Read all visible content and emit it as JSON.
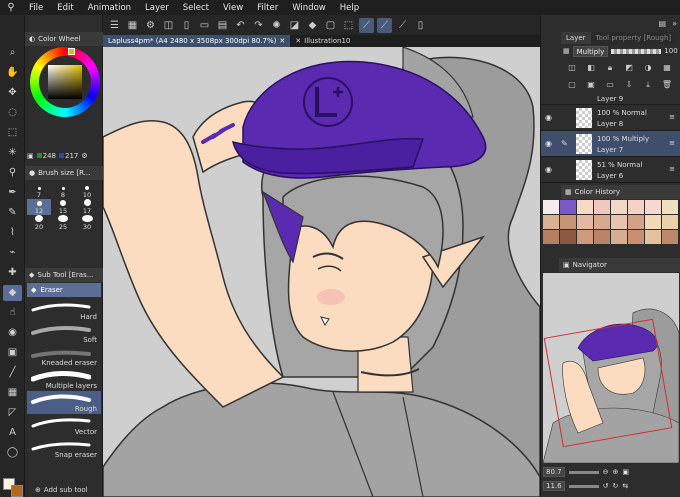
{
  "menu": [
    "File",
    "Edit",
    "Animation",
    "Layer",
    "Select",
    "View",
    "Filter",
    "Window",
    "Help"
  ],
  "tabs": [
    {
      "label": "Lapluss4pm* (A4 2480 x 3508px 300dpi 80.7%)",
      "active": true
    },
    {
      "label": "Illustration10",
      "active": false
    }
  ],
  "left_panel": {
    "color_wheel_title": "Color Wheel",
    "rgb_values": [
      "248",
      "217"
    ],
    "brush_size_title": "Brush size [R...",
    "brush_sizes": [
      "7",
      "8",
      "10",
      "12",
      "15",
      "17",
      "20",
      "25",
      "30"
    ],
    "selected_brush_size": "12",
    "sub_tool_title": "Sub Tool [Eras...",
    "active_subtool": "Eraser",
    "erasers": [
      "Hard",
      "Soft",
      "Kneaded eraser",
      "Multiple layers",
      "Rough",
      "Vector",
      "Snap eraser"
    ],
    "selected_eraser": "Rough",
    "add_sub_tool": "Add sub tool"
  },
  "right_panel": {
    "layer_tab": "Layer",
    "tool_property_tab": "Tool property [Rough]",
    "blend_mode": "Multiply",
    "opacity": "100",
    "layers": [
      {
        "top_label": "100 % Normal",
        "name": "Layer 8",
        "selected": false
      },
      {
        "top_label": "100 % Multiply",
        "name": "Layer 7",
        "selected": true
      },
      {
        "top_label": "51 % Normal",
        "name": "Layer 6",
        "selected": false
      }
    ],
    "partial_layer_name": "Layer 9",
    "color_history_title": "Color History",
    "color_history": [
      "#f4ecec",
      "#7a58c8",
      "#f7d9c6",
      "#f3c6c0",
      "#f0d7c9",
      "#f6d1c7",
      "#f7d7d2",
      "#efe1bf",
      "#d9b294",
      "#c89377",
      "#e6b8a3",
      "#d8a98e",
      "#e9c3ad",
      "#d5a089",
      "#f2d8b9",
      "#e9d0aa",
      "#b57f62",
      "#8c5a43",
      "#cf9a7c",
      "#b98367",
      "#d6ac92",
      "#c98f72",
      "#e3c09f",
      "#bb8a6d"
    ],
    "navigator_title": "Navigator",
    "zoom": "80.7",
    "rotation": "11.6"
  },
  "colors": {
    "accent": "#5b6f96",
    "cap": "#5a2ab0",
    "hair": "#9c9c9c",
    "skin": "#fcdcc0"
  }
}
